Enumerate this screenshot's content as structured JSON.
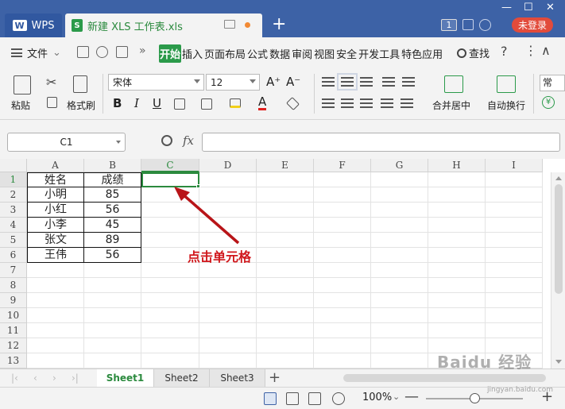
{
  "titlebar": {
    "app_tab": "WPS",
    "app_logo": "W",
    "doc_tab": "新建 XLS 工作表.xls",
    "doc_icon": "S",
    "new_tab": "+",
    "count_badge": "1",
    "login_button": "未登录",
    "window_controls": [
      "—",
      "☐",
      "✕"
    ]
  },
  "menubar": {
    "file_menu": "文件",
    "more_chevron": "»",
    "items": [
      {
        "label": "开始",
        "active": true
      },
      {
        "label": "插入"
      },
      {
        "label": "页面布局"
      },
      {
        "label": "公式"
      },
      {
        "label": "数据"
      },
      {
        "label": "审阅"
      },
      {
        "label": "视图"
      },
      {
        "label": "安全"
      },
      {
        "label": "开发工具"
      },
      {
        "label": "特色应用"
      }
    ],
    "search": "查找",
    "help": "?",
    "more": "⋮",
    "collapse": "∧"
  },
  "ribbon": {
    "paste": "粘贴",
    "format_painter": "格式刷",
    "font_name": "宋体",
    "font_size": "12",
    "grow_font": "A⁺",
    "shrink_font": "A⁻",
    "bold": "B",
    "italic": "I",
    "underline": "U",
    "merge_center": "合并居中",
    "wrap_text": "自动换行",
    "normal_style": "常",
    "currency": "¥"
  },
  "formula_bar": {
    "name_box": "C1",
    "fx": "fx",
    "content": ""
  },
  "grid": {
    "columns": [
      "A",
      "B",
      "C",
      "D",
      "E",
      "F",
      "G",
      "H",
      "I"
    ],
    "rows": [
      "1",
      "2",
      "3",
      "4",
      "5",
      "6",
      "7",
      "8",
      "9",
      "10",
      "11",
      "12",
      "13"
    ],
    "selected_column": "C",
    "selected_row": "1",
    "data": [
      [
        "姓名",
        "成绩"
      ],
      [
        "小明",
        "85"
      ],
      [
        "小红",
        "56"
      ],
      [
        "小李",
        "45"
      ],
      [
        "张文",
        "89"
      ],
      [
        "王伟",
        "56"
      ]
    ],
    "annotation": "点击单元格"
  },
  "sheets": {
    "nav": [
      "|‹",
      "‹",
      "›",
      "›|"
    ],
    "tabs": [
      {
        "label": "Sheet1",
        "active": true
      },
      {
        "label": "Sheet2"
      },
      {
        "label": "Sheet3"
      }
    ],
    "add": "+"
  },
  "statusbar": {
    "zoom": "100%",
    "zoom_out": "—",
    "zoom_in": "+",
    "zoom_level": 0.5
  },
  "watermark": "Baidu 经验",
  "watermark_sub": "jingyan.baidu.com",
  "colors": {
    "titlebar": "#3d62a6",
    "accent_green": "#2b9a4a",
    "login_red": "#e24b3b",
    "annotation_red": "#d0171c"
  }
}
